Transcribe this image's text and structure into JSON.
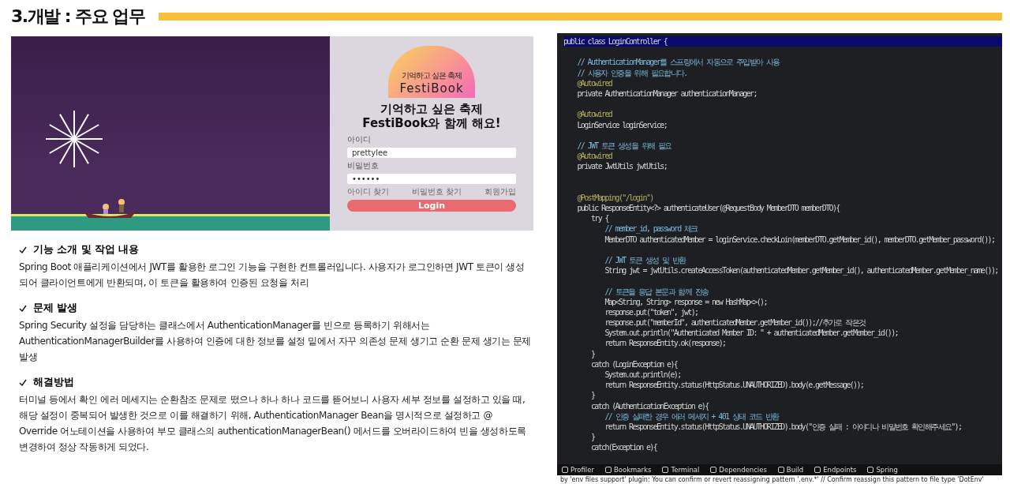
{
  "title": "3.개발 : 주요 업무",
  "login_screen": {
    "logo_tagline": "기억하고 싶은 축제",
    "logo_name": "FestiBook",
    "headline": [
      "기억하고 싶은 축제",
      "FestiBook와 함께 해요!"
    ],
    "fields": [
      {
        "label": "아이디",
        "value": "prettylee"
      },
      {
        "label": "비밀번호",
        "value": "••••••"
      }
    ],
    "links": [
      "아이디 찾기",
      "비밀번호 찾기",
      "회원가입"
    ],
    "button": "Login"
  },
  "sections": [
    {
      "heading": "기능 소개 및 작업 내용",
      "body": " Spring Boot 애플리케이션에서 JWT를 활용한 로그인 기능을 구현한 컨트롤러입니다. 사용자가 로그인하면 JWT 토큰이 생성되어 클라이언트에게 반환되며, 이 토큰을 활용하여 인증된 요청을 처리"
    },
    {
      "heading": "문제 발생",
      "body": "Spring Security 설정을 담당하는 클래스에서 AuthenticationManager를 빈으로 등록하기 위해서는 AuthenticationManagerBuilder를 사용하여 인증에 대한 정보를 설정 밑에서 자꾸 의존성 문제 생기고 순환 문제 생기는 문제 발생"
    },
    {
      "heading": "해결방법",
      "body": "터미널 등에서 확인 에러 메세지는 순환참조 문제로 떴으나 하나 하나 코드를 뜯어보니 사용자 세부 정보를 설정하고 있을 때, 해당 설정이 중복되어 발생한 것으로 이를 해결하기 위해, AuthenticationManager Bean을 명시적으로 설정하고 @ Override 어노테이션을 사용하여 부모 클래스의 authenticationManagerBean() 메서드를 오버라이드하여 빈을 생성하도록 변경하여 정상 작동하게 되었다."
    }
  ],
  "editor": {
    "lines": [
      {
        "kind": "code",
        "text": "public class LoginController {",
        "highlighted": true
      },
      {
        "kind": "blank",
        "highlighted": false
      },
      {
        "kind": "comment",
        "text": "    // AuthenticationManager를 스프링에서 자동으로 주입받아 사용",
        "highlighted": false
      },
      {
        "kind": "comment",
        "text": "    // 사용자 인증을 위해 필요합니다.",
        "highlighted": false
      },
      {
        "kind": "annotation",
        "text": "    @Autowired",
        "highlighted": false
      },
      {
        "kind": "code",
        "text": "    private AuthenticationManager authenticationManager;",
        "highlighted": false
      },
      {
        "kind": "blank",
        "highlighted": false
      },
      {
        "kind": "annotation",
        "text": "    @Autowired",
        "highlighted": false
      },
      {
        "kind": "code",
        "text": "    LoginService loginService;",
        "highlighted": false
      },
      {
        "kind": "blank",
        "highlighted": false
      },
      {
        "kind": "comment",
        "text": "    // JWT 토큰 생성을 위해 필요",
        "highlighted": false
      },
      {
        "kind": "annotation",
        "text": "    @Autowired",
        "highlighted": false
      },
      {
        "kind": "code",
        "text": "    private JwtUtils jwtUtils;",
        "highlighted": false
      },
      {
        "kind": "blank",
        "highlighted": false
      },
      {
        "kind": "blank",
        "highlighted": false
      },
      {
        "kind": "annotation",
        "text": "    @PostMapping(\"/login\")",
        "highlighted": false
      },
      {
        "kind": "code",
        "text": "    public ResponseEntity<?> authenticateUser(@RequestBody MemberDTO memberDTO){",
        "highlighted": false
      },
      {
        "kind": "code",
        "text": "        try {",
        "highlighted": false
      },
      {
        "kind": "comment",
        "text": "            // member_id, password 체크",
        "highlighted": false
      },
      {
        "kind": "code",
        "text": "            MemberDTO authenticatedMember = loginService.checkLoin(memberDTO.getMember_id(), memberDTO.getMember_password());",
        "highlighted": false
      },
      {
        "kind": "blank",
        "highlighted": false
      },
      {
        "kind": "comment",
        "text": "            // JWT 토큰 생성 및 반환",
        "highlighted": false
      },
      {
        "kind": "code",
        "text": "            String jwt = jwtUtils.createAccessToken(authenticatedMember.getMember_id(), authenticatedMember.getMember_name());",
        "highlighted": false
      },
      {
        "kind": "blank",
        "highlighted": false
      },
      {
        "kind": "comment",
        "text": "            // 토큰을 응답 본문과 함께 전송",
        "highlighted": false
      },
      {
        "kind": "code",
        "text": "            Map<String, String> response = new HashMap<>();",
        "highlighted": false
      },
      {
        "kind": "code",
        "text": "            response.put(\"token\", jwt);",
        "highlighted": false
      },
      {
        "kind": "code",
        "text": "            response.put(\"memberId\", authenticatedMember.getMember_id());//추가로 작은것",
        "highlighted": false
      },
      {
        "kind": "code",
        "text": "            System.out.println(\"Authenticated Member ID: \" + authenticatedMember.getMember_id());",
        "highlighted": false
      },
      {
        "kind": "code",
        "text": "            return ResponseEntity.ok(response);",
        "highlighted": false
      },
      {
        "kind": "code",
        "text": "        }",
        "highlighted": false
      },
      {
        "kind": "code",
        "text": "        catch (LoginException e){",
        "highlighted": false
      },
      {
        "kind": "code",
        "text": "            System.out.println(e);",
        "highlighted": false
      },
      {
        "kind": "code",
        "text": "            return ResponseEntity.status(HttpStatus.UNAUTHORIZED).body(e.getMessage());",
        "highlighted": false
      },
      {
        "kind": "code",
        "text": "        }",
        "highlighted": false
      },
      {
        "kind": "code",
        "text": "        catch (AuthenticationException e){",
        "highlighted": false
      },
      {
        "kind": "comment",
        "text": "            // 인증 실패한 경우 에러 메세지 + 401 상태 코드 반환",
        "highlighted": false
      },
      {
        "kind": "code",
        "text": "            return ResponseEntity.status(HttpStatus.UNAUTHORIZED).body(\"인증 실패 : 아이디나 비밀번호 확인해주세요\");",
        "highlighted": false
      },
      {
        "kind": "code",
        "text": "        }",
        "highlighted": false
      },
      {
        "kind": "code",
        "text": "        catch(Exception e){",
        "highlighted": false
      }
    ],
    "tool_tabs": [
      "Profiler",
      "Bookmarks",
      "Terminal",
      "Dependencies",
      "Build",
      "Endpoints",
      "Spring"
    ],
    "status_bar": "by 'env files support' plugin: You can confirm or revert reassigning pattern '.env.*' // Confirm reassign this pattern to file type 'DotEnv'"
  }
}
